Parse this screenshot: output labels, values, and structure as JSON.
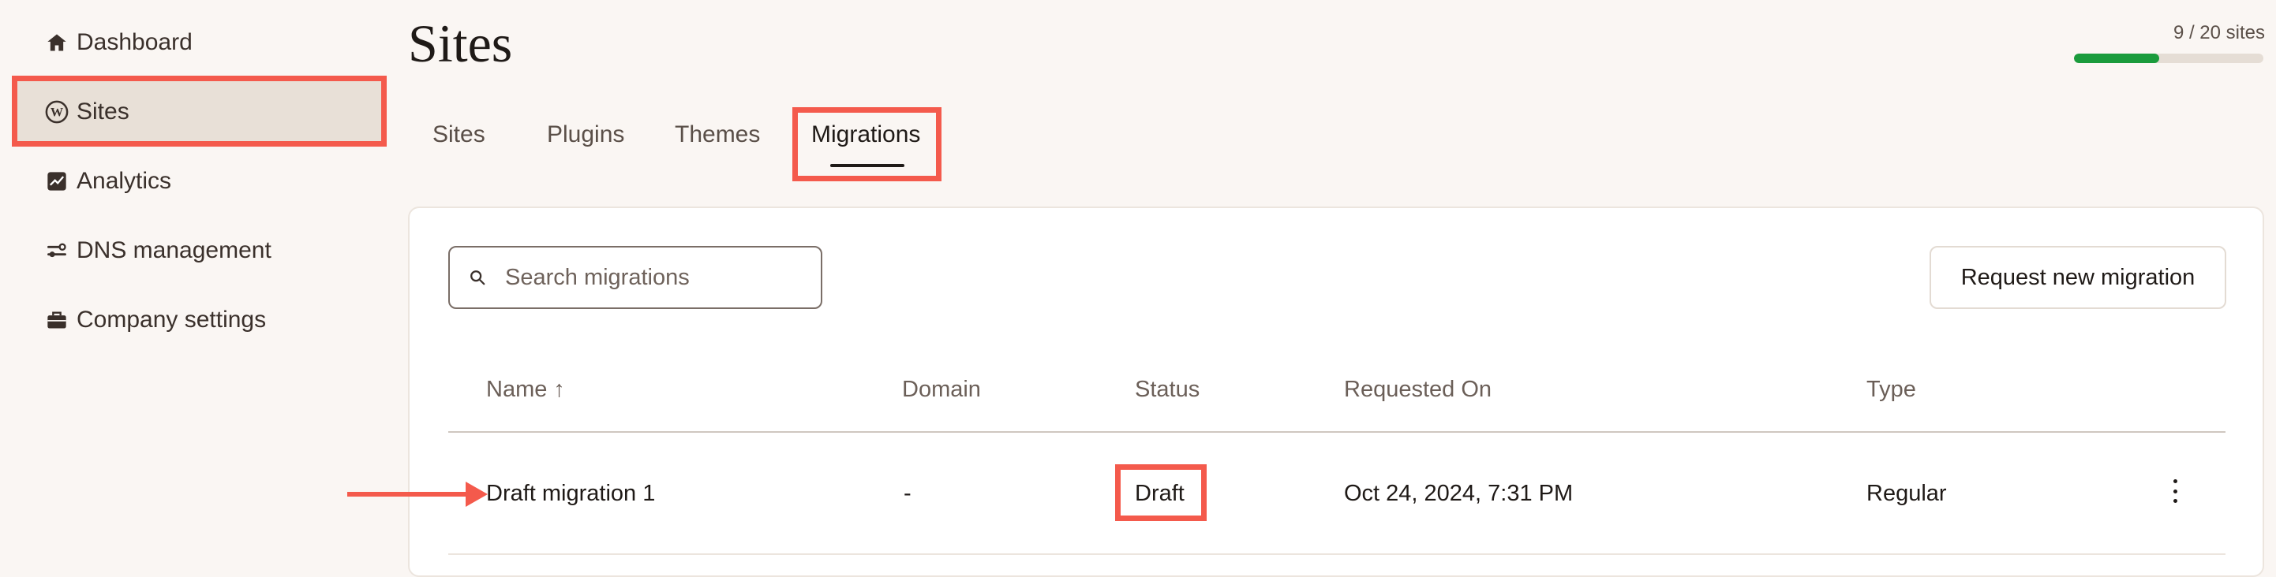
{
  "sidebar": {
    "items": [
      {
        "label": "Dashboard",
        "icon": "home-icon"
      },
      {
        "label": "Sites",
        "icon": "wordpress-icon"
      },
      {
        "label": "Analytics",
        "icon": "analytics-icon"
      },
      {
        "label": "DNS management",
        "icon": "dns-icon"
      },
      {
        "label": "Company settings",
        "icon": "briefcase-icon"
      }
    ],
    "active": "Sites"
  },
  "header": {
    "title": "Sites",
    "usage_label": "9 / 20 sites",
    "usage_fraction": 0.45
  },
  "tabs": [
    {
      "label": "Sites"
    },
    {
      "label": "Plugins"
    },
    {
      "label": "Themes"
    },
    {
      "label": "Migrations"
    }
  ],
  "active_tab": "Migrations",
  "search": {
    "placeholder": "Search migrations"
  },
  "request_button": "Request new migration",
  "table": {
    "columns": [
      "Name ↑",
      "Domain",
      "Status",
      "Requested On",
      "Type"
    ],
    "rows": [
      {
        "name": "Draft migration 1",
        "domain": "-",
        "status": "Draft",
        "requested_on": "Oct 24, 2024, 7:31 PM",
        "type": "Regular"
      }
    ]
  },
  "colors": {
    "accent_highlight": "#f45a4c",
    "progress": "#1a9b3c",
    "background": "#faf6f3"
  }
}
